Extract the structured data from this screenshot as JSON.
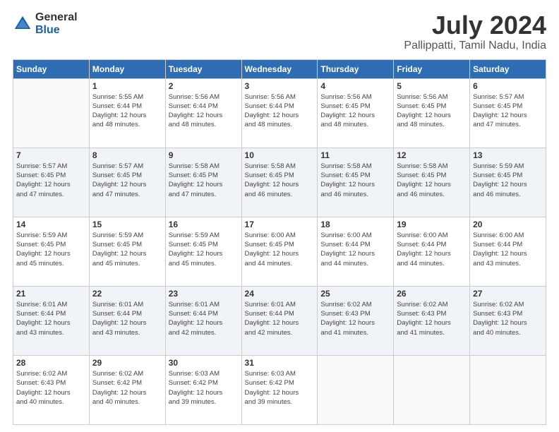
{
  "logo": {
    "general": "General",
    "blue": "Blue"
  },
  "title": "July 2024",
  "subtitle": "Pallippatti, Tamil Nadu, India",
  "days_of_week": [
    "Sunday",
    "Monday",
    "Tuesday",
    "Wednesday",
    "Thursday",
    "Friday",
    "Saturday"
  ],
  "weeks": [
    [
      {
        "day": "",
        "empty": true
      },
      {
        "day": "1",
        "sunrise": "5:55 AM",
        "sunset": "6:44 PM",
        "daylight": "12 hours and 48 minutes."
      },
      {
        "day": "2",
        "sunrise": "5:56 AM",
        "sunset": "6:44 PM",
        "daylight": "12 hours and 48 minutes."
      },
      {
        "day": "3",
        "sunrise": "5:56 AM",
        "sunset": "6:44 PM",
        "daylight": "12 hours and 48 minutes."
      },
      {
        "day": "4",
        "sunrise": "5:56 AM",
        "sunset": "6:45 PM",
        "daylight": "12 hours and 48 minutes."
      },
      {
        "day": "5",
        "sunrise": "5:56 AM",
        "sunset": "6:45 PM",
        "daylight": "12 hours and 48 minutes."
      },
      {
        "day": "6",
        "sunrise": "5:57 AM",
        "sunset": "6:45 PM",
        "daylight": "12 hours and 47 minutes."
      }
    ],
    [
      {
        "day": "7",
        "sunrise": "5:57 AM",
        "sunset": "6:45 PM",
        "daylight": "12 hours and 47 minutes."
      },
      {
        "day": "8",
        "sunrise": "5:57 AM",
        "sunset": "6:45 PM",
        "daylight": "12 hours and 47 minutes."
      },
      {
        "day": "9",
        "sunrise": "5:58 AM",
        "sunset": "6:45 PM",
        "daylight": "12 hours and 47 minutes."
      },
      {
        "day": "10",
        "sunrise": "5:58 AM",
        "sunset": "6:45 PM",
        "daylight": "12 hours and 46 minutes."
      },
      {
        "day": "11",
        "sunrise": "5:58 AM",
        "sunset": "6:45 PM",
        "daylight": "12 hours and 46 minutes."
      },
      {
        "day": "12",
        "sunrise": "5:58 AM",
        "sunset": "6:45 PM",
        "daylight": "12 hours and 46 minutes."
      },
      {
        "day": "13",
        "sunrise": "5:59 AM",
        "sunset": "6:45 PM",
        "daylight": "12 hours and 46 minutes."
      }
    ],
    [
      {
        "day": "14",
        "sunrise": "5:59 AM",
        "sunset": "6:45 PM",
        "daylight": "12 hours and 45 minutes."
      },
      {
        "day": "15",
        "sunrise": "5:59 AM",
        "sunset": "6:45 PM",
        "daylight": "12 hours and 45 minutes."
      },
      {
        "day": "16",
        "sunrise": "5:59 AM",
        "sunset": "6:45 PM",
        "daylight": "12 hours and 45 minutes."
      },
      {
        "day": "17",
        "sunrise": "6:00 AM",
        "sunset": "6:45 PM",
        "daylight": "12 hours and 44 minutes."
      },
      {
        "day": "18",
        "sunrise": "6:00 AM",
        "sunset": "6:44 PM",
        "daylight": "12 hours and 44 minutes."
      },
      {
        "day": "19",
        "sunrise": "6:00 AM",
        "sunset": "6:44 PM",
        "daylight": "12 hours and 44 minutes."
      },
      {
        "day": "20",
        "sunrise": "6:00 AM",
        "sunset": "6:44 PM",
        "daylight": "12 hours and 43 minutes."
      }
    ],
    [
      {
        "day": "21",
        "sunrise": "6:01 AM",
        "sunset": "6:44 PM",
        "daylight": "12 hours and 43 minutes."
      },
      {
        "day": "22",
        "sunrise": "6:01 AM",
        "sunset": "6:44 PM",
        "daylight": "12 hours and 43 minutes."
      },
      {
        "day": "23",
        "sunrise": "6:01 AM",
        "sunset": "6:44 PM",
        "daylight": "12 hours and 42 minutes."
      },
      {
        "day": "24",
        "sunrise": "6:01 AM",
        "sunset": "6:44 PM",
        "daylight": "12 hours and 42 minutes."
      },
      {
        "day": "25",
        "sunrise": "6:02 AM",
        "sunset": "6:43 PM",
        "daylight": "12 hours and 41 minutes."
      },
      {
        "day": "26",
        "sunrise": "6:02 AM",
        "sunset": "6:43 PM",
        "daylight": "12 hours and 41 minutes."
      },
      {
        "day": "27",
        "sunrise": "6:02 AM",
        "sunset": "6:43 PM",
        "daylight": "12 hours and 40 minutes."
      }
    ],
    [
      {
        "day": "28",
        "sunrise": "6:02 AM",
        "sunset": "6:43 PM",
        "daylight": "12 hours and 40 minutes."
      },
      {
        "day": "29",
        "sunrise": "6:02 AM",
        "sunset": "6:42 PM",
        "daylight": "12 hours and 40 minutes."
      },
      {
        "day": "30",
        "sunrise": "6:03 AM",
        "sunset": "6:42 PM",
        "daylight": "12 hours and 39 minutes."
      },
      {
        "day": "31",
        "sunrise": "6:03 AM",
        "sunset": "6:42 PM",
        "daylight": "12 hours and 39 minutes."
      },
      {
        "day": "",
        "empty": true
      },
      {
        "day": "",
        "empty": true
      },
      {
        "day": "",
        "empty": true
      }
    ]
  ],
  "labels": {
    "sunrise": "Sunrise:",
    "sunset": "Sunset:",
    "daylight": "Daylight:"
  }
}
